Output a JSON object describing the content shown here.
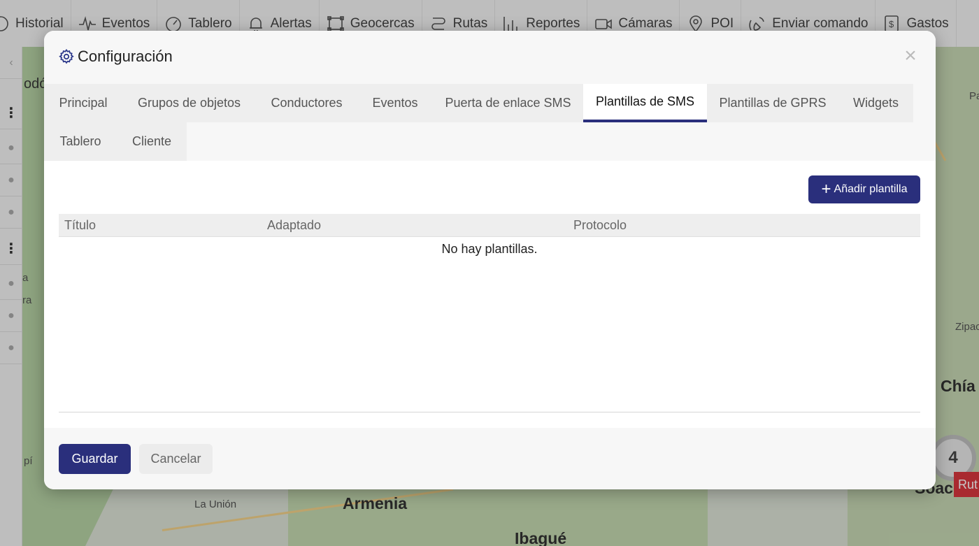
{
  "nav": {
    "items": [
      {
        "label": "Historial",
        "icon": "history-icon"
      },
      {
        "label": "Eventos",
        "icon": "pulse-icon"
      },
      {
        "label": "Tablero",
        "icon": "gauge-icon"
      },
      {
        "label": "Alertas",
        "icon": "bell-icon"
      },
      {
        "label": "Geocercas",
        "icon": "geofence-icon"
      },
      {
        "label": "Rutas",
        "icon": "route-icon"
      },
      {
        "label": "Reportes",
        "icon": "bar-chart-icon"
      },
      {
        "label": "Cámaras",
        "icon": "camera-icon"
      },
      {
        "label": "POI",
        "icon": "map-pin-icon"
      },
      {
        "label": "Enviar comando",
        "icon": "satellite-icon"
      },
      {
        "label": "Gastos",
        "icon": "receipt-icon"
      }
    ]
  },
  "map": {
    "labels": [
      "Armenia",
      "Ibagué",
      "La Unión",
      "Chía",
      "Zipac",
      "Soacha",
      "odó",
      "Pa",
      "pí",
      "a",
      "ra"
    ],
    "cluster_count": "4",
    "route_tag": "Rut"
  },
  "modal": {
    "title": "Configuración",
    "close": "×",
    "tabs": [
      {
        "label": "Principal",
        "active": false
      },
      {
        "label": "Grupos de objetos",
        "active": false
      },
      {
        "label": "Conductores",
        "active": false
      },
      {
        "label": "Eventos",
        "active": false
      },
      {
        "label": "Puerta de enlace SMS",
        "active": false
      },
      {
        "label": "Plantillas de SMS",
        "active": true
      },
      {
        "label": "Plantillas de GPRS",
        "active": false
      },
      {
        "label": "Widgets",
        "active": false
      },
      {
        "label": "Tablero",
        "active": false
      },
      {
        "label": "Cliente",
        "active": false
      }
    ],
    "add_button": "Añadir plantilla",
    "table": {
      "columns": [
        "Título",
        "Adaptado",
        "Protocolo"
      ],
      "empty_message": "No hay plantillas."
    },
    "footer": {
      "save": "Guardar",
      "cancel": "Cancelar"
    }
  },
  "colors": {
    "accent": "#2a2f7c",
    "route_tag": "#d9363e"
  }
}
